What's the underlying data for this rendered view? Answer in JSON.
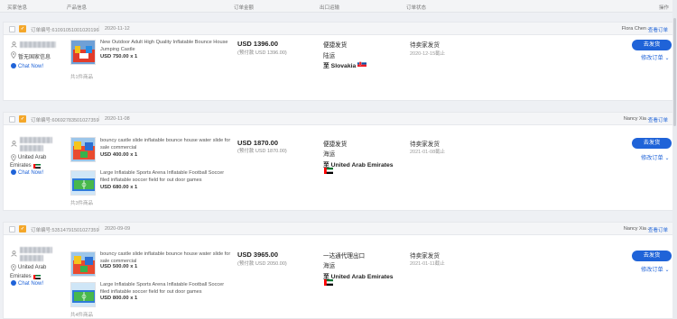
{
  "table_header": {
    "buyer": "买家信息",
    "product": "产品信息",
    "amount": "订单金额",
    "shipping": "出口运输",
    "status": "订单状态",
    "actions": "操作"
  },
  "orders": [
    {
      "order_no": "订单编号:6109105100102019​6",
      "date": "2020-11-12",
      "agent": "Flora Chen",
      "view_order": "查看订单",
      "buyer_country": "暂无国家信息",
      "buyer_country_line2": "",
      "chat": "Chat Now!",
      "items": [
        {
          "title": "New Outdoor Adult High Quality Inflatable Bounce House Jumping Castle",
          "price": "USD 750.00 x 1"
        }
      ],
      "item_count": "共1件商品",
      "amount": "USD 1396.00",
      "amount_sub": "(预付款 USD 1396.00)",
      "ship_main": "便捷发货",
      "ship_mode": "陆运",
      "ship_to": "至 Slovakia",
      "status": "待卖家发货",
      "status_date": "2020-12-15截止",
      "btn_ship": "去发货",
      "edit": "修改订单"
    },
    {
      "order_no": "订单编号:6069278350102735​9",
      "date": "2020-11-08",
      "agent": "Nancy Xia",
      "view_order": "查看订单",
      "buyer_country": "United Arab",
      "buyer_country_line2": "Emirates",
      "chat": "Chat Now!",
      "items": [
        {
          "title": "bouncy castle slide inflatable bounce house water slide for sale commercial",
          "price": "USD 400.00 x 1"
        },
        {
          "title": "Large Inflatable Sports Arena Inflatable Football Soccer filed inflatable soccer field for out door games",
          "price": "USD 680.00 x 1"
        }
      ],
      "item_count": "共3件商品",
      "amount": "USD 1870.00",
      "amount_sub": "(预付款 USD 1870.00)",
      "ship_main": "便捷发货",
      "ship_mode": "海运",
      "ship_to": "至 United Arab Emirates",
      "status": "待卖家发货",
      "status_date": "2021-01-08截止",
      "btn_ship": "去发货",
      "edit": "修改订单"
    },
    {
      "order_no": "订单编号:5351479150102735​9",
      "date": "2020-09-09",
      "agent": "Nancy Xia",
      "view_order": "查看订单",
      "buyer_country": "United Arab",
      "buyer_country_line2": "Emirates",
      "chat": "Chat Now!",
      "items": [
        {
          "title": "bouncy castle slide inflatable bounce house water slide for sale commercial",
          "price": "USD 500.00 x 1"
        },
        {
          "title": "Large Inflatable Sports Arena Inflatable Football Soccer filed inflatable soccer field for out door games",
          "price": "USD 800.00 x 1"
        }
      ],
      "item_count": "共4件商品",
      "amount": "USD 3965.00",
      "amount_sub": "(预付款 USD 2050.00)",
      "ship_main": "一达通代理出口",
      "ship_mode": "海运",
      "ship_to": "至 United Arab Emirates",
      "status": "待卖家发货",
      "status_date": "2021-01-11截止",
      "btn_ship": "去发货",
      "edit": "修改订单"
    }
  ],
  "colors": {
    "accent": "#1f63d8",
    "badge": "#f4a72a"
  },
  "icons": {
    "user": "user-icon",
    "location": "location-pin-icon",
    "chat": "chat-icon",
    "chevron": "chevron-down-icon"
  }
}
